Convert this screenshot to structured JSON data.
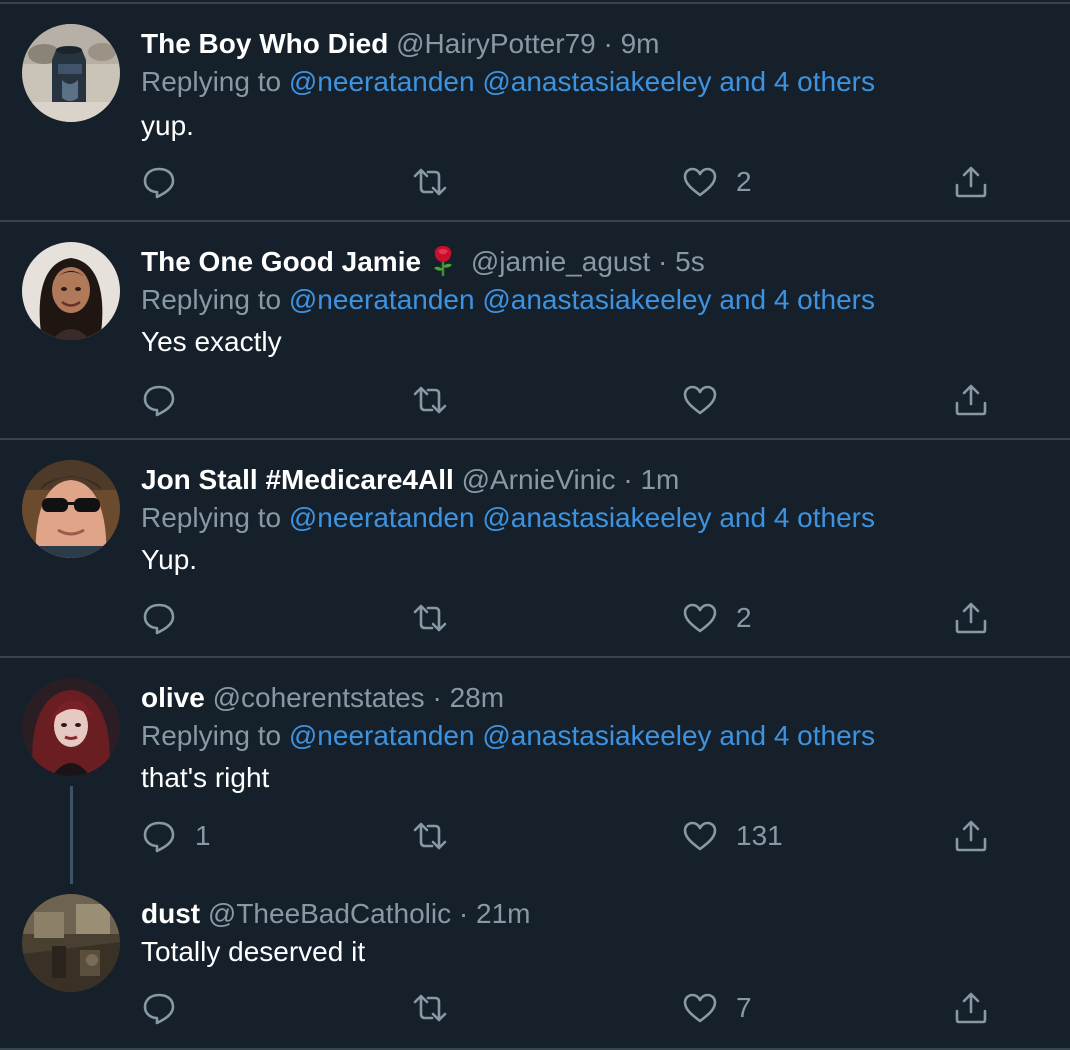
{
  "colors": {
    "background": "#15202b",
    "divider": "#38444d",
    "muted": "#8899a6",
    "link": "#3d93e0",
    "text": "#ffffff"
  },
  "tweets": [
    {
      "name": "The Boy Who Died",
      "handle": "@HairyPotter79",
      "separator": "·",
      "time": "9m",
      "replying_prefix": "Replying to",
      "mentions": "@neeratanden @anastasiakeeley and 4 others",
      "text": "yup.",
      "reply_count": "",
      "like_count": "2",
      "avatar": "pottery-avatar"
    },
    {
      "name": "The One Good Jamie",
      "emoji": "rose-icon",
      "handle": "@jamie_agust",
      "separator": "·",
      "time": "5s",
      "replying_prefix": "Replying to",
      "mentions": "@neeratanden @anastasiakeeley and 4 others",
      "text": "Yes exactly",
      "reply_count": "",
      "like_count": "",
      "avatar": "portrait-avatar"
    },
    {
      "name": "Jon Stall #Medicare4All",
      "handle": "@ArnieVinic",
      "separator": "·",
      "time": "1m",
      "replying_prefix": "Replying to",
      "mentions": "@neeratanden @anastasiakeeley and 4 others",
      "text": "Yup.",
      "reply_count": "",
      "like_count": "2",
      "avatar": "sunglasses-avatar"
    },
    {
      "name": "olive",
      "handle": "@coherentstates",
      "separator": "·",
      "time": "28m",
      "replying_prefix": "Replying to",
      "mentions": "@neeratanden @anastasiakeeley and 4 others",
      "text": "that's right",
      "reply_count": "1",
      "like_count": "131",
      "avatar": "red-hair-avatar"
    },
    {
      "name": "dust",
      "handle": "@TheeBadCatholic",
      "separator": "·",
      "time": "21m",
      "text": "Totally deserved it",
      "reply_count": "",
      "like_count": "7",
      "avatar": "dim-room-avatar"
    }
  ]
}
